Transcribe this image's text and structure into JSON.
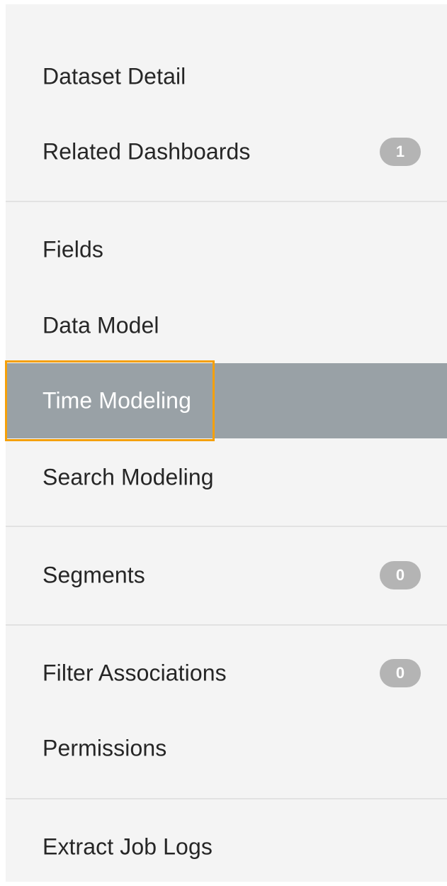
{
  "nav": {
    "items": [
      {
        "label": "Dataset Detail"
      },
      {
        "label": "Related Dashboards",
        "badge": "1"
      },
      {
        "label": "Fields"
      },
      {
        "label": "Data Model"
      },
      {
        "label": "Time Modeling",
        "active": true
      },
      {
        "label": "Search Modeling"
      },
      {
        "label": "Segments",
        "badge": "0"
      },
      {
        "label": "Filter Associations",
        "badge": "0"
      },
      {
        "label": "Permissions"
      },
      {
        "label": "Extract Job Logs"
      }
    ]
  },
  "colors": {
    "sidebar_bg": "#f4f4f4",
    "active_bg": "#99a1a6",
    "focus_ring": "#f5a00a",
    "badge_bg": "#b4b4b4",
    "divider": "#e2e2e2",
    "text": "#262626"
  }
}
